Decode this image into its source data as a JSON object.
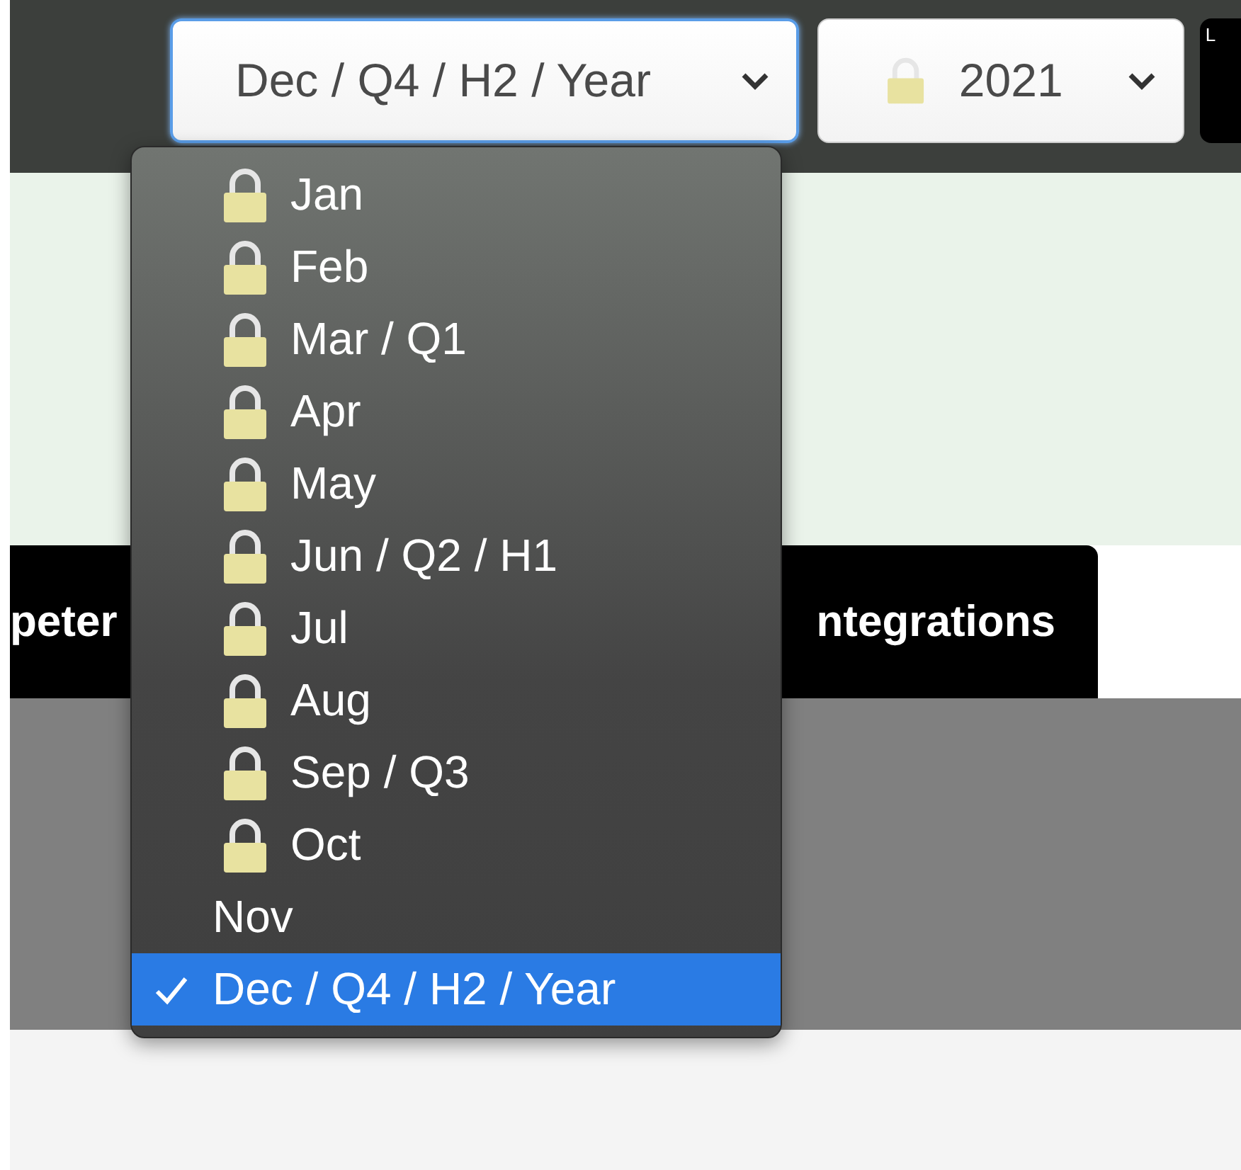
{
  "period_select": {
    "value": "Dec / Q4 / H2 / Year",
    "expanded": true
  },
  "year_select": {
    "value": "2021",
    "locked": true
  },
  "edge_button": {
    "label": "L"
  },
  "tabs": [
    {
      "label": "peter",
      "selected": false
    },
    {
      "label": "ntegrations",
      "selected": false
    }
  ],
  "period_menu": [
    {
      "label": "Jan",
      "locked": true,
      "selected": false
    },
    {
      "label": "Feb",
      "locked": true,
      "selected": false
    },
    {
      "label": "Mar / Q1",
      "locked": true,
      "selected": false
    },
    {
      "label": "Apr",
      "locked": true,
      "selected": false
    },
    {
      "label": "May",
      "locked": true,
      "selected": false
    },
    {
      "label": "Jun / Q2 / H1",
      "locked": true,
      "selected": false
    },
    {
      "label": "Jul",
      "locked": true,
      "selected": false
    },
    {
      "label": "Aug",
      "locked": true,
      "selected": false
    },
    {
      "label": "Sep / Q3",
      "locked": true,
      "selected": false
    },
    {
      "label": "Oct",
      "locked": true,
      "selected": false
    },
    {
      "label": "Nov",
      "locked": false,
      "selected": false
    },
    {
      "label": "Dec / Q4 / H2 / Year",
      "locked": false,
      "selected": true
    }
  ]
}
